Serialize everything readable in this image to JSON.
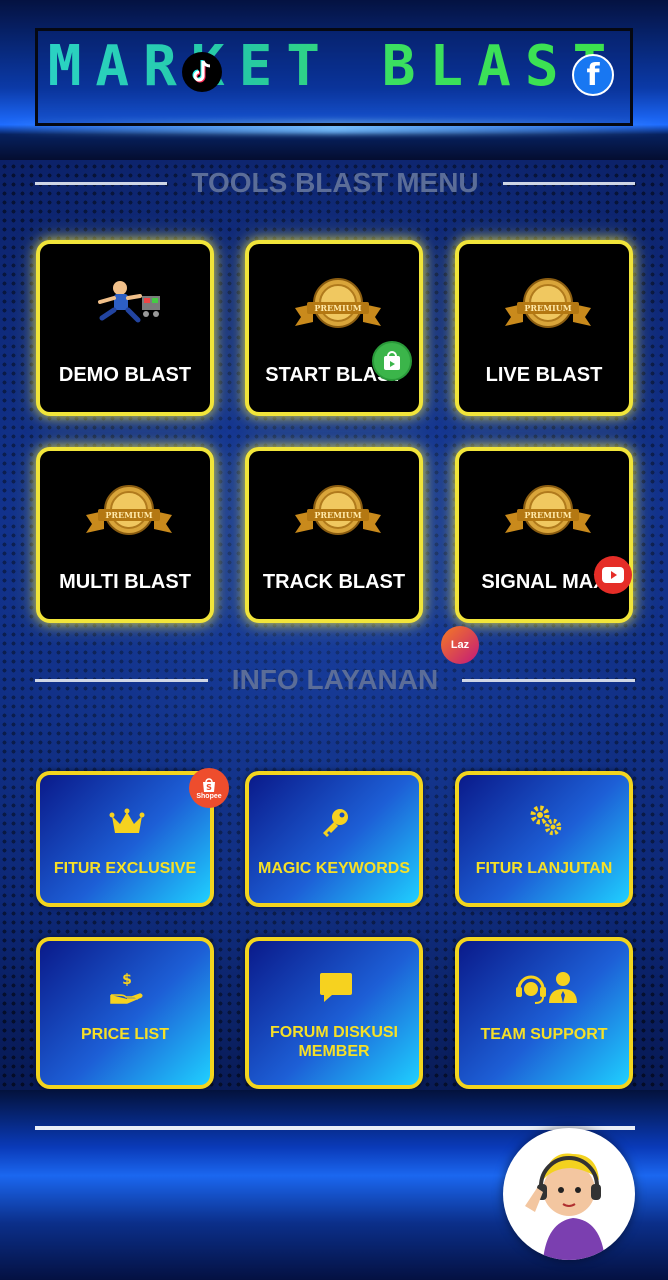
{
  "header": {
    "title": "MARKET BLAST"
  },
  "tools_section": {
    "heading": "TOOLS BLAST MENU",
    "cards": [
      {
        "label": "DEMO BLAST",
        "icon": "runner-icon"
      },
      {
        "label": "START BLAST",
        "icon": "premium-medal-icon"
      },
      {
        "label": "LIVE BLAST",
        "icon": "premium-medal-icon"
      },
      {
        "label": "MULTI BLAST",
        "icon": "premium-medal-icon"
      },
      {
        "label": "TRACK BLAST",
        "icon": "premium-medal-icon"
      },
      {
        "label": "SIGNAL MAX",
        "icon": "premium-medal-icon"
      }
    ],
    "medal_text": "PREMIUM"
  },
  "info_section": {
    "heading": "INFO LAYANAN",
    "cards": [
      {
        "label": "FITUR EXCLUSIVE",
        "icon": "crown-icon"
      },
      {
        "label": "MAGIC KEYWORDS",
        "icon": "key-icon"
      },
      {
        "label": "FITUR LANJUTAN",
        "icon": "gears-icon"
      },
      {
        "label": "PRICE LIST",
        "icon": "money-hand-icon"
      },
      {
        "label": "FORUM DISKUSI MEMBER",
        "icon": "chat-bubble-icon"
      },
      {
        "label": "TEAM SUPPORT",
        "icon": "support-team-icon"
      }
    ]
  },
  "floating": {
    "shopee_badge": "Shopee",
    "lazada_badge": "Laz"
  },
  "colors": {
    "card_border": "#f1e53a",
    "info_text": "#f6e027",
    "title_gradient_start": "#2bd3c4",
    "title_gradient_end": "#3ce34b"
  }
}
